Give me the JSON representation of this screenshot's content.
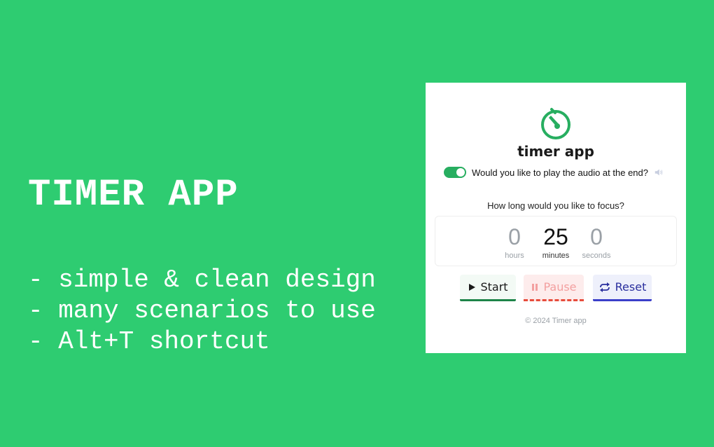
{
  "promo": {
    "title": "TIMER APP",
    "features": [
      "- simple & clean design",
      "- many scenarios to use",
      "- Alt+T shortcut"
    ]
  },
  "app": {
    "logo_icon": "stopwatch-icon",
    "name": "timer app",
    "audio_toggle": {
      "enabled": true,
      "label": "Would you like to play the audio at the end?",
      "icon": "speaker-icon"
    },
    "focus_question": "How long would you like to focus?",
    "timer": {
      "hours": {
        "value": "0",
        "label": "hours"
      },
      "minutes": {
        "value": "25",
        "label": "minutes"
      },
      "seconds": {
        "value": "0",
        "label": "seconds"
      }
    },
    "buttons": {
      "start": "Start",
      "pause": "Pause",
      "reset": "Reset"
    },
    "footer": "© 2024 Timer app"
  },
  "colors": {
    "background": "#2ecc71",
    "accent_green": "#27ae60",
    "pause_red": "#e74c3c",
    "reset_blue": "#3b3fc9"
  }
}
